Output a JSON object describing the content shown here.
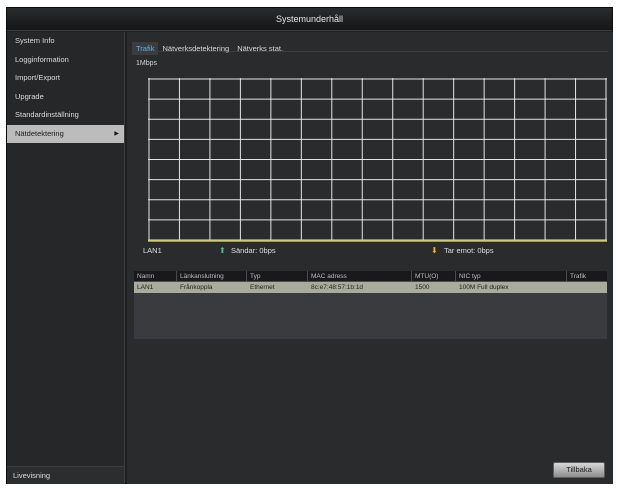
{
  "window": {
    "title": "Systemunderhåll"
  },
  "sidebar": {
    "items": [
      {
        "label": "System Info",
        "active": false
      },
      {
        "label": "Logginformation",
        "active": false
      },
      {
        "label": "Import/Export",
        "active": false
      },
      {
        "label": "Upgrade",
        "active": false
      },
      {
        "label": "Standardinställning",
        "active": false
      },
      {
        "label": "Nätdetektering",
        "active": true
      }
    ],
    "active_arrow": "▶",
    "bottom_label": "Livevisning"
  },
  "tabs": [
    {
      "label": "Trafik",
      "active": true
    },
    {
      "label": "Nätverksdetektering",
      "active": false
    },
    {
      "label": "Nätverks stat.",
      "active": false
    }
  ],
  "graph": {
    "unit": "1Mbps",
    "grid_color": "#e4e4e4",
    "baseline_color": "#c8c84a",
    "vertical_lines": 16,
    "horizontal_lines": 9
  },
  "legend": {
    "interface": "LAN1",
    "send_label": "Sändar: 0bps",
    "receive_label": "Tar emot: 0bps",
    "send_arrow": "⬆",
    "receive_arrow": "⬇"
  },
  "table": {
    "headers": [
      "Namn",
      "Länkanslutning",
      "Typ",
      "MAC adress",
      "MTU(O)",
      "NIC typ",
      "Trafik"
    ],
    "rows": [
      [
        "LAN1",
        "Frånkoppla",
        "Ethernet",
        "8c:e7:48:57:1b:1d",
        "1500",
        "100M Full duplex",
        ""
      ]
    ]
  },
  "buttons": {
    "back": "Tillbaka"
  },
  "colors": {
    "active_tab_text": "#4fb4ff",
    "send_arrow": "#43c97a",
    "receive_arrow": "#f0b327",
    "selected_row": "#a9ab9c"
  }
}
